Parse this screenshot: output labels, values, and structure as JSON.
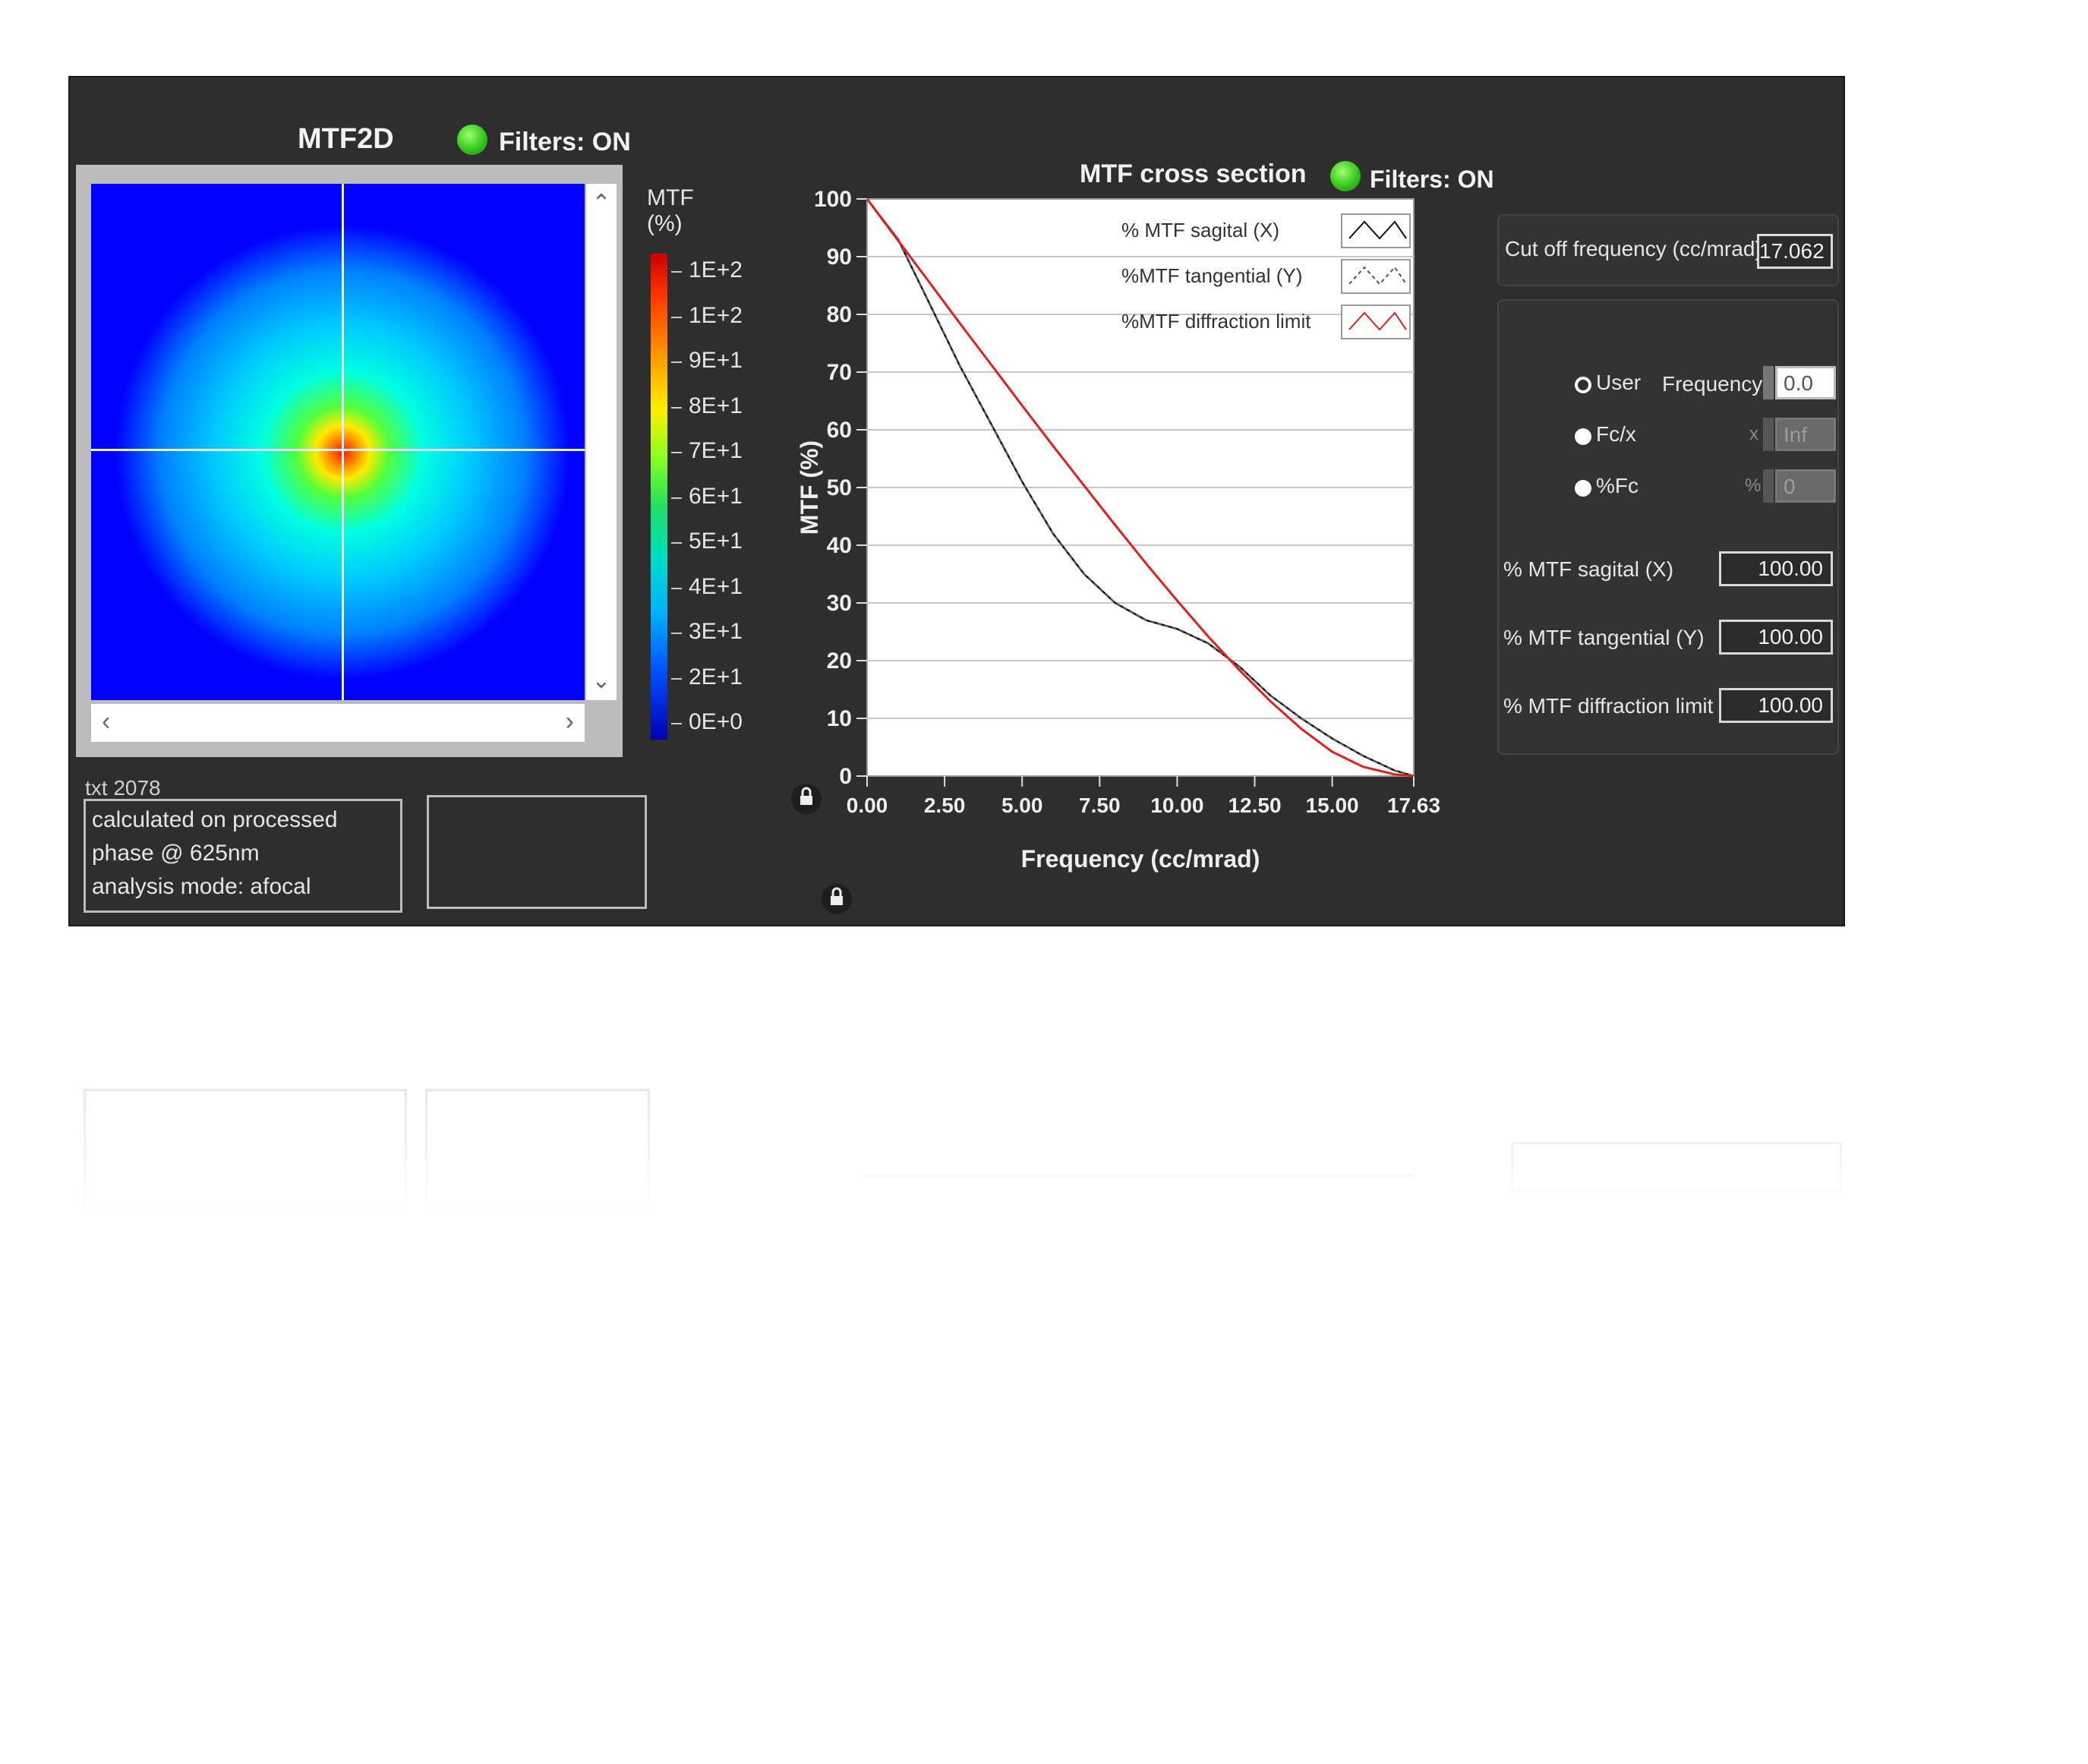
{
  "mtf2d": {
    "title": "MTF2D",
    "filters_label": "Filters: ON",
    "colorbar_title": "MTF\n(%)",
    "colorbar_ticks": [
      "1E+2",
      "1E+2",
      "9E+1",
      "8E+1",
      "7E+1",
      "6E+1",
      "5E+1",
      "4E+1",
      "3E+1",
      "2E+1",
      "0E+0"
    ],
    "status_line": "txt 2078",
    "info_lines": [
      "calculated on processed",
      "phase @ 625nm",
      "analysis mode: afocal"
    ]
  },
  "cross_section": {
    "title": "MTF cross section",
    "filters_label": "Filters: ON"
  },
  "chart_data": {
    "type": "line",
    "xlabel": "Frequency (cc/mrad)",
    "ylabel": "MTF (%)",
    "xlim": [
      0,
      17.63
    ],
    "ylim": [
      0,
      100
    ],
    "x_ticks": [
      "0.00",
      "2.50",
      "5.00",
      "7.50",
      "10.00",
      "12.50",
      "15.00",
      "17.63"
    ],
    "y_ticks": [
      "0",
      "10",
      "20",
      "30",
      "40",
      "50",
      "60",
      "70",
      "80",
      "90",
      "100"
    ],
    "grid": true,
    "legend_position": "top-right",
    "series": [
      {
        "name": "% MTF  sagital (X)",
        "color": "#111111",
        "points": [
          [
            0,
            100
          ],
          [
            1,
            93
          ],
          [
            2,
            82
          ],
          [
            3,
            71
          ],
          [
            4,
            61
          ],
          [
            5,
            51
          ],
          [
            6,
            42
          ],
          [
            7,
            35
          ],
          [
            8,
            30
          ],
          [
            9,
            27
          ],
          [
            10,
            25.5
          ],
          [
            11,
            23
          ],
          [
            12,
            19
          ],
          [
            13,
            14
          ],
          [
            14,
            10
          ],
          [
            15,
            6.5
          ],
          [
            16,
            3.5
          ],
          [
            17,
            1
          ],
          [
            17.63,
            0
          ]
        ]
      },
      {
        "name": "%MTF  tangential (Y)",
        "color": "#555555",
        "points": [
          [
            0,
            100
          ],
          [
            1,
            93
          ],
          [
            2,
            82
          ],
          [
            3,
            71
          ],
          [
            4,
            61
          ],
          [
            5,
            51
          ],
          [
            6,
            42
          ],
          [
            7,
            35
          ],
          [
            8,
            30
          ],
          [
            9,
            27
          ],
          [
            10,
            25.5
          ],
          [
            11,
            23
          ],
          [
            12,
            19
          ],
          [
            13,
            14
          ],
          [
            14,
            10
          ],
          [
            15,
            6.5
          ],
          [
            16,
            3.5
          ],
          [
            17,
            1
          ],
          [
            17.63,
            0
          ]
        ]
      },
      {
        "name": "%MTF  diffraction limit",
        "color": "#e02020",
        "points": [
          [
            0,
            100
          ],
          [
            1,
            92.8
          ],
          [
            2,
            85.6
          ],
          [
            3,
            78.4
          ],
          [
            4,
            71.3
          ],
          [
            5,
            64.2
          ],
          [
            6,
            57.2
          ],
          [
            7,
            50.3
          ],
          [
            8,
            43.5
          ],
          [
            9,
            36.8
          ],
          [
            10,
            30.4
          ],
          [
            11,
            24.2
          ],
          [
            12,
            18.4
          ],
          [
            13,
            13
          ],
          [
            14,
            8.2
          ],
          [
            15,
            4.2
          ],
          [
            16,
            1.6
          ],
          [
            17,
            0.3
          ],
          [
            17.63,
            0
          ]
        ]
      }
    ]
  },
  "right_panel": {
    "cutoff_label": "Cut off frequency (cc/mrad)",
    "cutoff_value": "17.062",
    "radio_user": "User",
    "radio_fcx": "Fc/x",
    "radio_pfc": "%Fc",
    "frequency_label": "Frequency",
    "frequency_value": "0.0",
    "fcx_prefix": "x",
    "fcx_value": "Inf",
    "pfc_prefix": "%",
    "pfc_value": "0",
    "sagital_label": "% MTF sagital (X)",
    "sagital_value": "100.00",
    "tangential_label": "% MTF tangential (Y)",
    "tangential_value": "100.00",
    "diffraction_label": "% MTF diffraction limit",
    "diffraction_value": "100.00"
  }
}
